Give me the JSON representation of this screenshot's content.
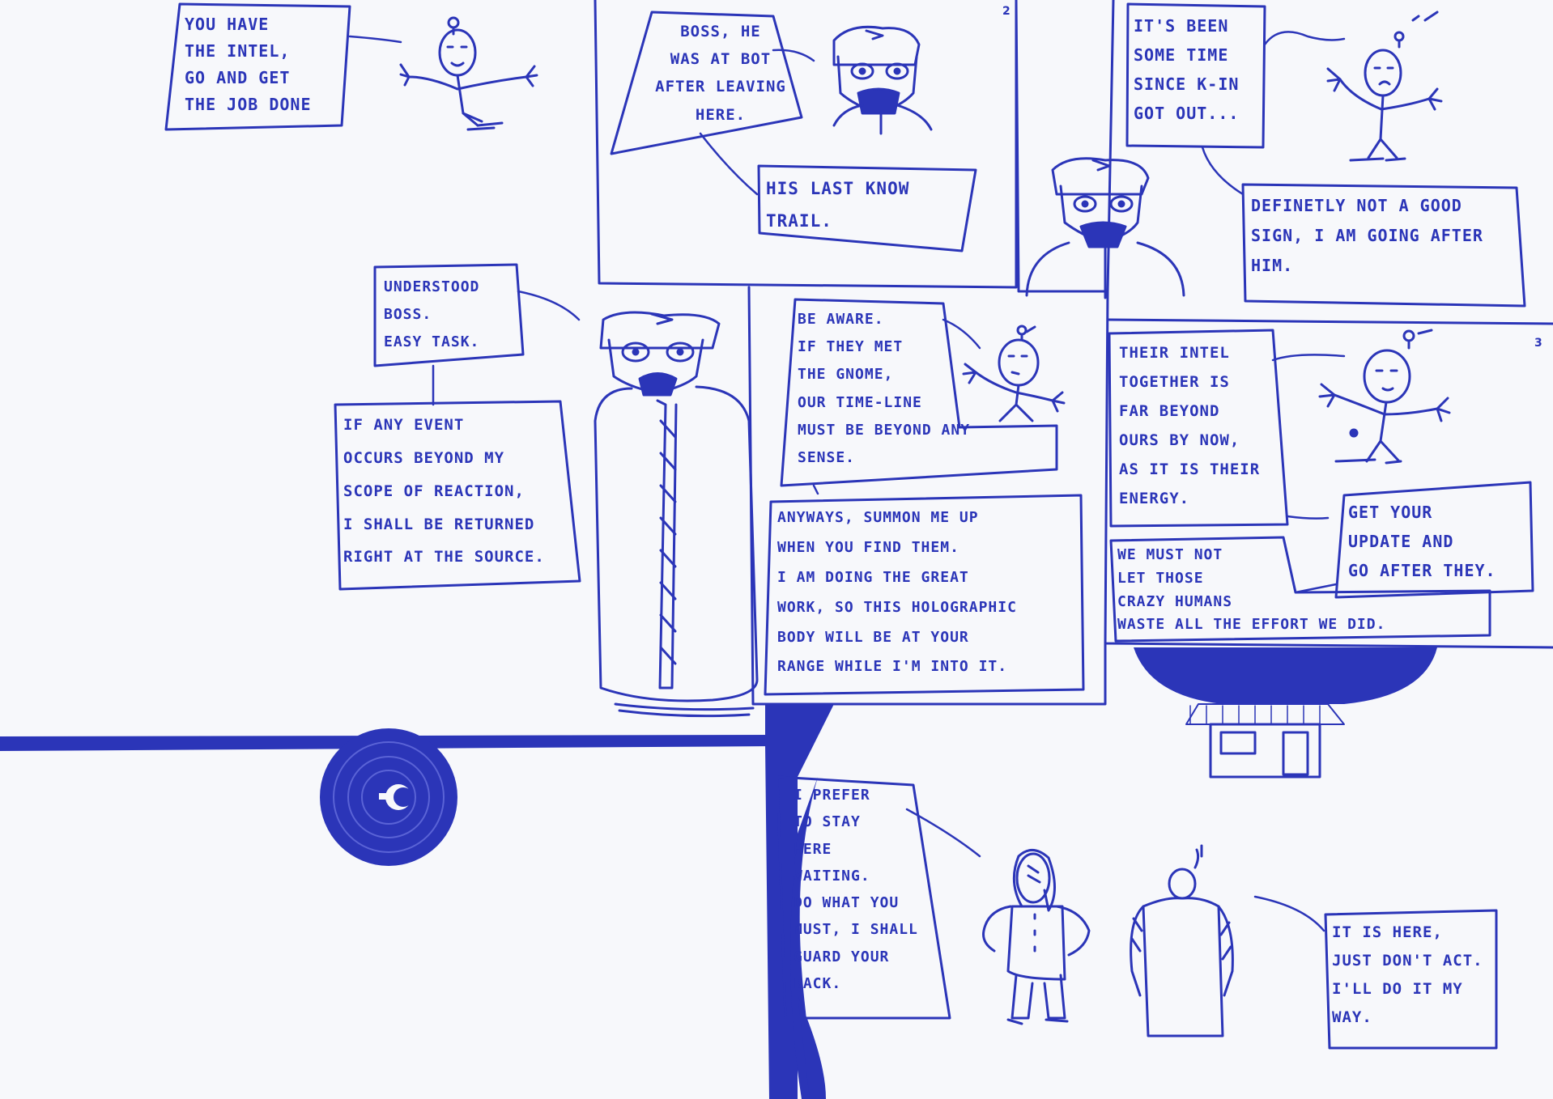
{
  "ink_color": "#2b35b8",
  "paper_color": "#f7f8fb",
  "page_numbers": [
    "2",
    "3"
  ],
  "bubbles": {
    "b1": "You have\nthe intel,\nGo and get\nthe job done",
    "b2": "Boss, he\nwas at bot\nafter leaving\nhere.",
    "b3": "His last know\ntrail.",
    "b4": "It's been\nsome time\nsince K-in\ngot out...",
    "b5": "Definetly not a good\nsign, I am going after\nhim.",
    "b6": "Understood\nBoss.\nEasy task.",
    "b7": "If any event\noccurs beyond my\nscope of reaction,\nI shall be returned\nright at the source.",
    "b8": "Be aware.\nIf they met\nthe gnome,\nour time-line\nmust be beyond any\nsense.",
    "b9": "Anyways, summon me up\nwhen you find them.\nI am doing the great\nwork, so this holographic\nbody will be at your\nrange while I'm into it.",
    "b10": "Their intel\ntogether is\nfar beyond\nours by now,\nas it is their\nenergy.",
    "b11": "Get your\nupdate and\ngo after they.",
    "b12": "We must not\nlet those\ncrazy humans\nwaste all the effort we did.",
    "b13": "I prefer\nto stay\nhere\nwaiting.\nDo what you\nmust, I shall\nguard your\nback.",
    "b14": "It is here,\njust don't act.\nI'll do it my\nway."
  }
}
